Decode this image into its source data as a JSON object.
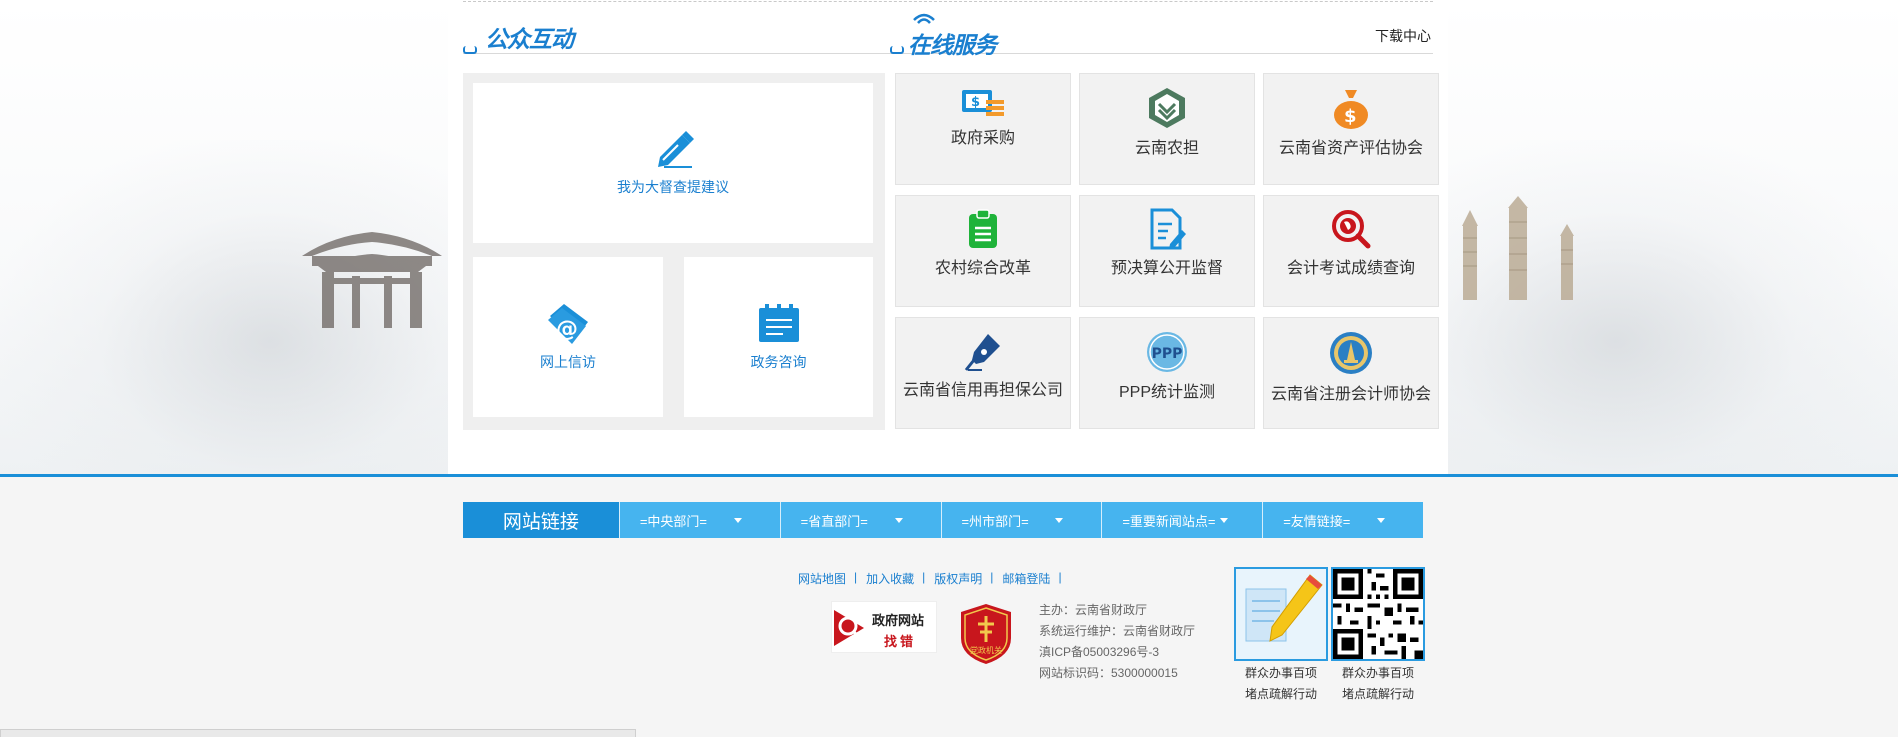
{
  "header": {
    "left_title": "公众互动",
    "right_title": "在线服务",
    "download_label": "下载中心"
  },
  "interaction": {
    "big_card_label": "我为大督查提建议",
    "card_letters_label": "网上信访",
    "card_consult_label": "政务咨询"
  },
  "services": [
    {
      "label": "政府采购",
      "icon": "procurement-icon"
    },
    {
      "label": "云南农担",
      "icon": "agri-guarantee-icon"
    },
    {
      "label": "云南省资产评估协会",
      "icon": "money-bag-icon"
    },
    {
      "label": "农村综合改革",
      "icon": "clipboard-icon"
    },
    {
      "label": "预决算公开监督",
      "icon": "document-edit-icon"
    },
    {
      "label": "会计考试成绩查询",
      "icon": "globe-search-icon"
    },
    {
      "label": "云南省信用再担保公司",
      "icon": "fountain-pen-icon"
    },
    {
      "label": "PPP统计监测",
      "icon": "ppp-icon"
    },
    {
      "label": "云南省注册会计师协会",
      "icon": "cpa-emblem-icon"
    }
  ],
  "ppp_badge_text": "PPP",
  "links": {
    "title": "网站链接",
    "selects": [
      "=中央部门=",
      "=省直部门=",
      "=州市部门=",
      "=重要新闻站点=",
      "=友情链接="
    ]
  },
  "footer_nav": [
    "网站地图",
    "加入收藏",
    "版权声明",
    "邮箱登陆"
  ],
  "footer_badges": {
    "find_error_line1": "政府网站",
    "find_error_line2": "找错",
    "party_text": "党政机关"
  },
  "footer_info": [
    "主办：云南省财政厅",
    "系统运行维护：云南省财政厅",
    "滇ICP备05003296号-3",
    "网站标识码：5300000015"
  ],
  "qr_items": [
    {
      "caption_line1": "群众办事百项",
      "caption_line2": "堵点疏解行动"
    },
    {
      "caption_line1": "群众办事百项",
      "caption_line2": "堵点疏解行动"
    }
  ],
  "colors": {
    "brand_blue": "#1a8fd8",
    "link_blue": "#1a7fcf",
    "select_blue": "#46b4ef"
  }
}
